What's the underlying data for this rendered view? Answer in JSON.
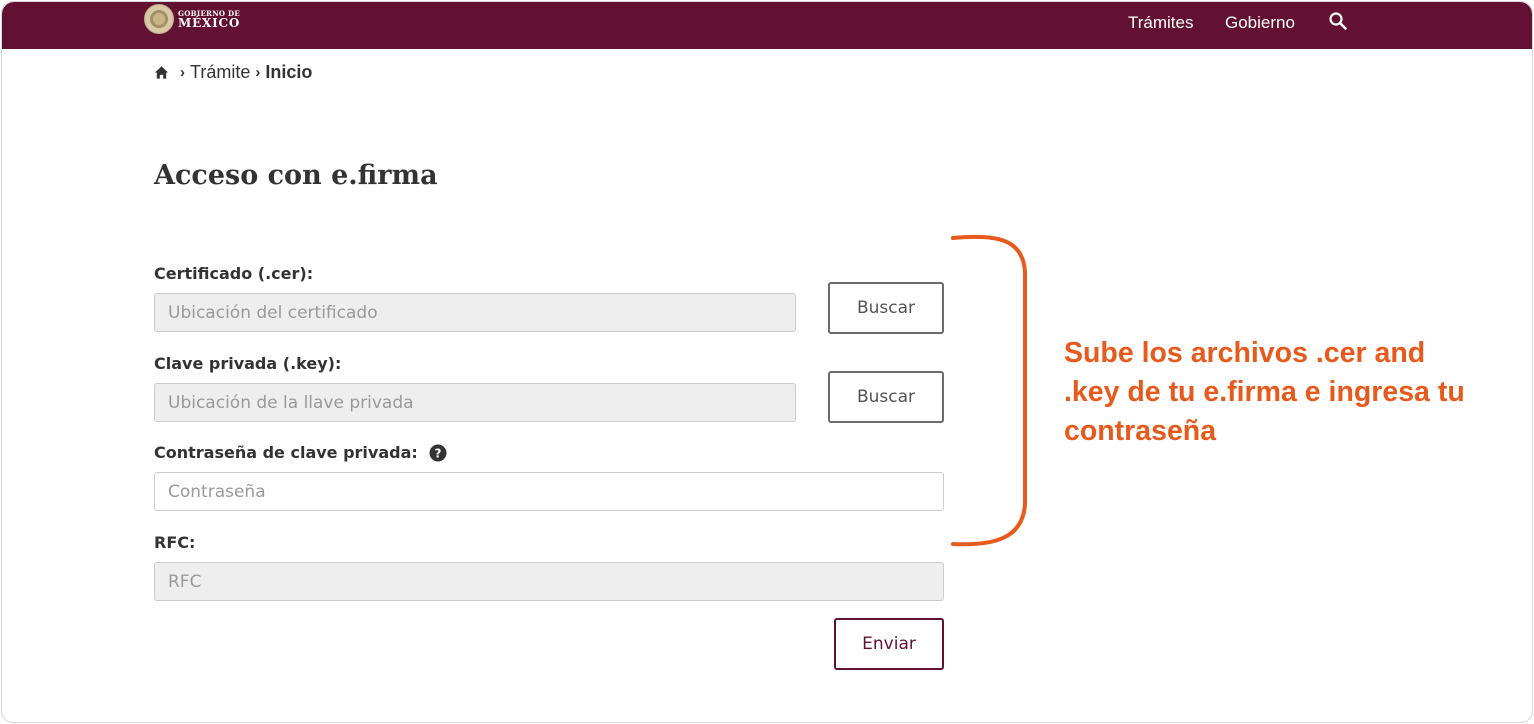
{
  "header": {
    "logo": {
      "line1": "GOBIERNO DE",
      "line2": "MÉXICO",
      "icon": "mexico-seal"
    },
    "nav": [
      {
        "label": "Trámites"
      },
      {
        "label": "Gobierno"
      }
    ],
    "search_icon": "search-icon",
    "background": "#621132"
  },
  "breadcrumb": {
    "home_icon": "home-icon",
    "items": [
      {
        "label": "Trámite"
      },
      {
        "label": "Inicio"
      }
    ]
  },
  "form": {
    "title": "Acceso con e.firma",
    "certificado": {
      "label": "Certificado (.cer):",
      "placeholder": "Ubicación del certificado",
      "value": "",
      "button": "Buscar"
    },
    "clave": {
      "label": "Clave privada (.key):",
      "placeholder": "Ubicación de la llave privada",
      "value": "",
      "button": "Buscar"
    },
    "password": {
      "label": "Contraseña de clave privada:",
      "placeholder": "Contraseña",
      "value": "",
      "help_icon": "question-circle-icon"
    },
    "rfc": {
      "label": "RFC:",
      "placeholder": "RFC",
      "value": ""
    },
    "submit": "Enviar"
  },
  "annotation": {
    "text": "Sube los archivos .cer and .key de tu e.firma e ingresa tu contraseña",
    "color": "#e85a1c"
  }
}
